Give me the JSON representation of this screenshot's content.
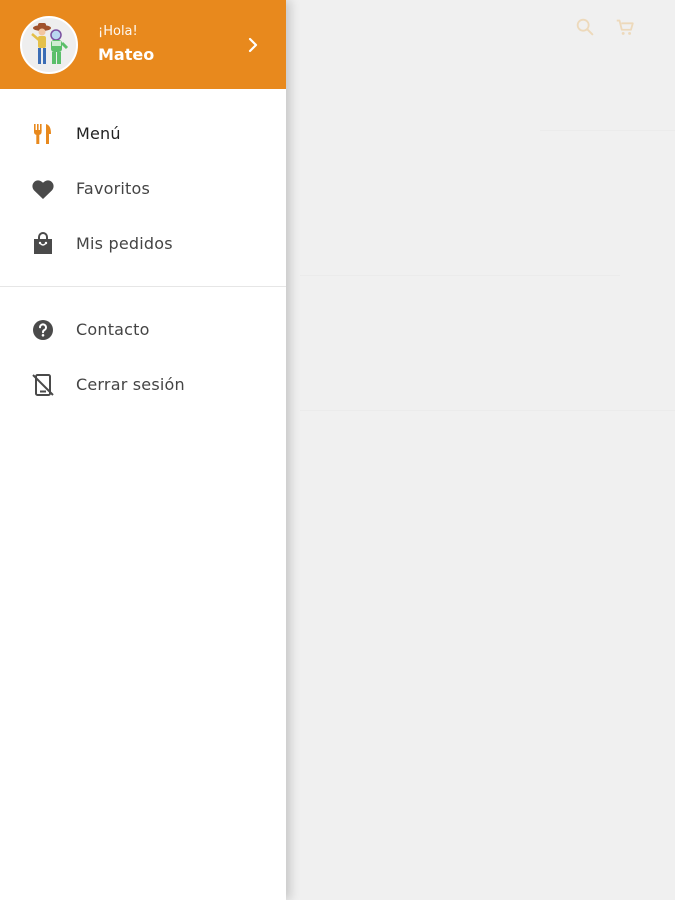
{
  "colors": {
    "accent": "#e8891d",
    "drawer_bg": "#ffffff",
    "backdrop": "#f0f0f0",
    "icon_dark": "#444444",
    "text": "#444444"
  },
  "header": {
    "greeting": "¡Hola!",
    "user_name": "Mateo",
    "avatar_icon": "user-avatar",
    "chevron_icon": "chevron-right-icon"
  },
  "menu_primary": [
    {
      "label": "Menú",
      "icon": "utensils-icon",
      "active": true
    },
    {
      "label": "Favoritos",
      "icon": "heart-icon",
      "active": false
    },
    {
      "label": "Mis pedidos",
      "icon": "shopping-bag-icon",
      "active": false
    }
  ],
  "menu_secondary": [
    {
      "label": "Contacto",
      "icon": "help-icon",
      "active": false
    },
    {
      "label": "Cerrar sesión",
      "icon": "logout-phone-icon",
      "active": false
    }
  ],
  "background_toolbar": {
    "search_icon": "search-icon",
    "cart_icon": "cart-icon"
  }
}
